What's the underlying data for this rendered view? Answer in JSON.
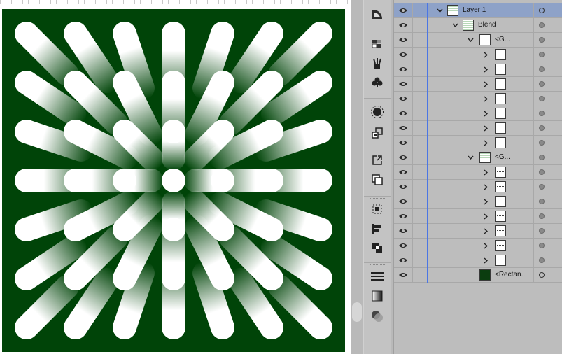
{
  "canvas": {
    "background_color": "#004408",
    "dot_color": "#ffffff",
    "grid_size": 7
  },
  "toolbar": {
    "tools": [
      "perspective-grid-icon",
      "swatches-icon",
      "brushes-icon",
      "symbols-icon",
      "appearance-icon",
      "transform-icon",
      "export-icon",
      "artboards-icon",
      "align-icon",
      "transform-align-icon",
      "pathfinder-icon",
      "stroke-icon",
      "gradient-icon",
      "transparency-icon"
    ]
  },
  "layers": {
    "accent_color": "#4b76e4",
    "selected_row_color": "#8ea2c8",
    "rows": [
      {
        "label": "Layer 1",
        "depth": 0,
        "expanded": true,
        "thumb": "blend",
        "selected": true
      },
      {
        "label": "Blend",
        "depth": 1,
        "expanded": true,
        "thumb": "blend"
      },
      {
        "label": "<G...",
        "depth": 2,
        "expanded": true,
        "thumb": "white"
      },
      {
        "label": "",
        "depth": 3,
        "expanded": false,
        "thumb": "white"
      },
      {
        "label": "",
        "depth": 3,
        "expanded": false,
        "thumb": "white"
      },
      {
        "label": "",
        "depth": 3,
        "expanded": false,
        "thumb": "white"
      },
      {
        "label": "",
        "depth": 3,
        "expanded": false,
        "thumb": "white"
      },
      {
        "label": "",
        "depth": 3,
        "expanded": false,
        "thumb": "white"
      },
      {
        "label": "",
        "depth": 3,
        "expanded": false,
        "thumb": "white"
      },
      {
        "label": "",
        "depth": 3,
        "expanded": false,
        "thumb": "white"
      },
      {
        "label": "<G...",
        "depth": 2,
        "expanded": true,
        "thumb": "blend"
      },
      {
        "label": "",
        "depth": 3,
        "expanded": false,
        "thumb": "dots"
      },
      {
        "label": "",
        "depth": 3,
        "expanded": false,
        "thumb": "dots"
      },
      {
        "label": "",
        "depth": 3,
        "expanded": false,
        "thumb": "dots"
      },
      {
        "label": "",
        "depth": 3,
        "expanded": false,
        "thumb": "dots"
      },
      {
        "label": "",
        "depth": 3,
        "expanded": false,
        "thumb": "dots"
      },
      {
        "label": "",
        "depth": 3,
        "expanded": false,
        "thumb": "dots"
      },
      {
        "label": "",
        "depth": 3,
        "expanded": false,
        "thumb": "dots"
      },
      {
        "label": "<Rectan...",
        "depth": 2,
        "expanded": null,
        "thumb": "dark"
      }
    ]
  }
}
